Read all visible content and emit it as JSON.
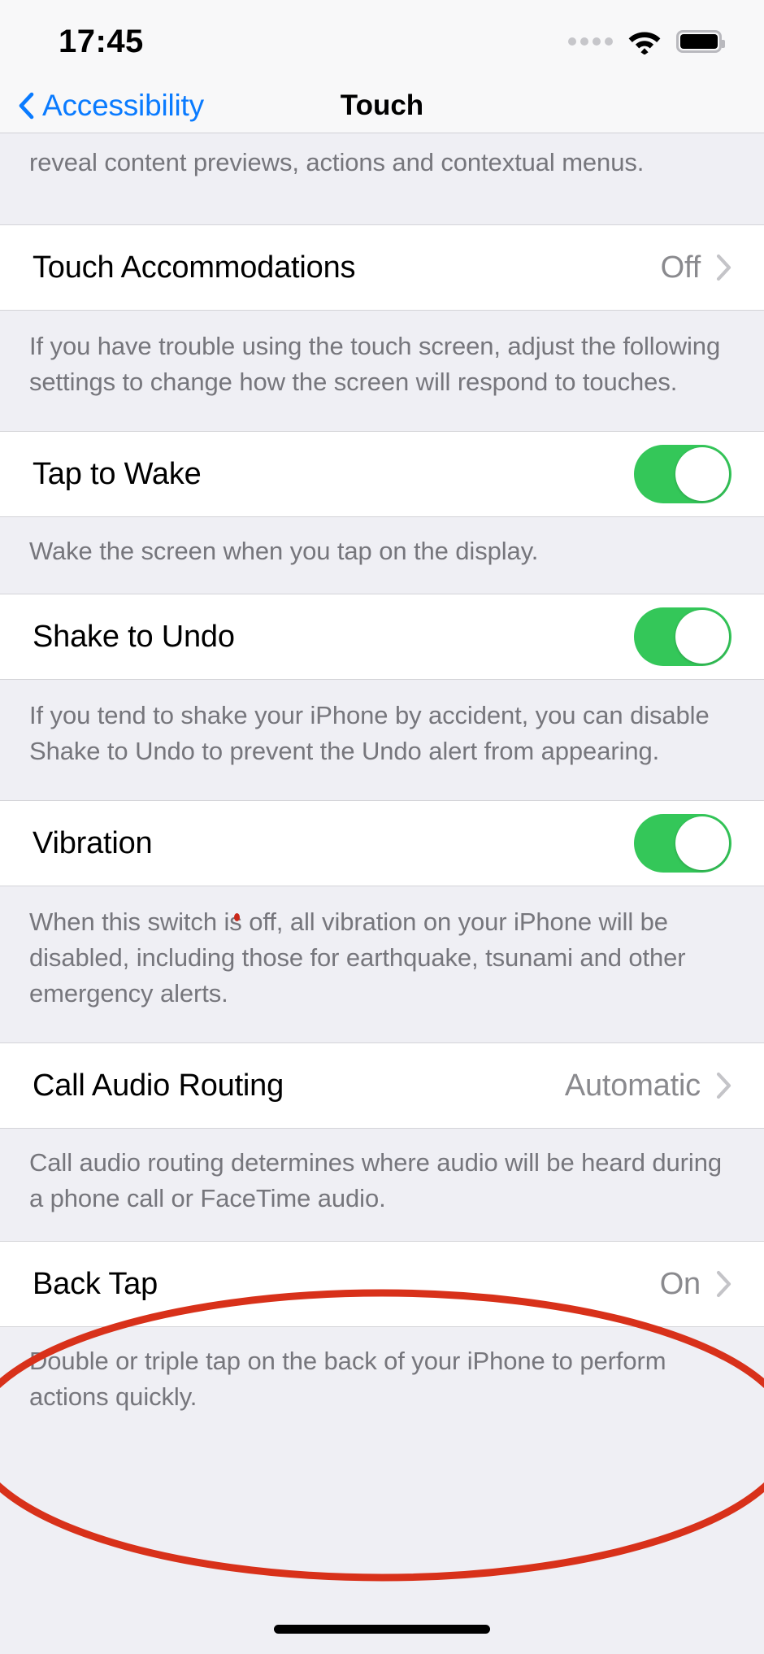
{
  "statusbar": {
    "time": "17:45",
    "cellular_icon": "cellular-dots-icon",
    "wifi_icon": "wifi-icon",
    "battery_icon": "battery-full-icon"
  },
  "navbar": {
    "back_label": "Accessibility",
    "back_icon": "chevron-left-icon",
    "title": "Touch"
  },
  "list": {
    "top_footer_partial": "reveal content previews, actions and contextual menus.",
    "sections": [
      {
        "row": {
          "label": "Touch Accommodations",
          "value": "Off",
          "type": "disclosure",
          "icon": "chevron-right-icon"
        },
        "footer": "If you have trouble using the touch screen, adjust the following settings to change how the screen will respond to touches."
      },
      {
        "row": {
          "label": "Tap to Wake",
          "type": "toggle",
          "toggle_state": "on"
        },
        "footer": "Wake the screen when you tap on the display."
      },
      {
        "row": {
          "label": "Shake to Undo",
          "type": "toggle",
          "toggle_state": "on"
        },
        "footer": "If you tend to shake your iPhone by accident, you can disable Shake to Undo to prevent the Undo alert from appearing."
      },
      {
        "row": {
          "label": "Vibration",
          "type": "toggle",
          "toggle_state": "on"
        },
        "footer": "When this switch is off, all vibration on your iPhone will be disabled, including those for earthquake, tsunami and other emergency alerts."
      },
      {
        "row": {
          "label": "Call Audio Routing",
          "value": "Automatic",
          "type": "disclosure",
          "icon": "chevron-right-icon"
        },
        "footer": "Call audio routing determines where audio will be heard during a phone call or FaceTime audio."
      },
      {
        "row": {
          "label": "Back Tap",
          "value": "On",
          "type": "disclosure",
          "icon": "chevron-right-icon"
        },
        "footer": "Double or triple tap on the back of your iPhone to perform actions quickly."
      }
    ]
  },
  "annotation": {
    "shape": "ellipse",
    "color": "#D8311A",
    "stroke_width": 9,
    "target": "Back Tap"
  },
  "colors": {
    "accent_blue": "#0A7BFF",
    "toggle_green": "#34C759",
    "group_background": "#FFFFFF",
    "page_background": "#EFEFF4",
    "footer_text": "#76767C",
    "value_text": "#8A8A8E",
    "annotation_red": "#D8311A"
  },
  "home_indicator": "home-indicator"
}
